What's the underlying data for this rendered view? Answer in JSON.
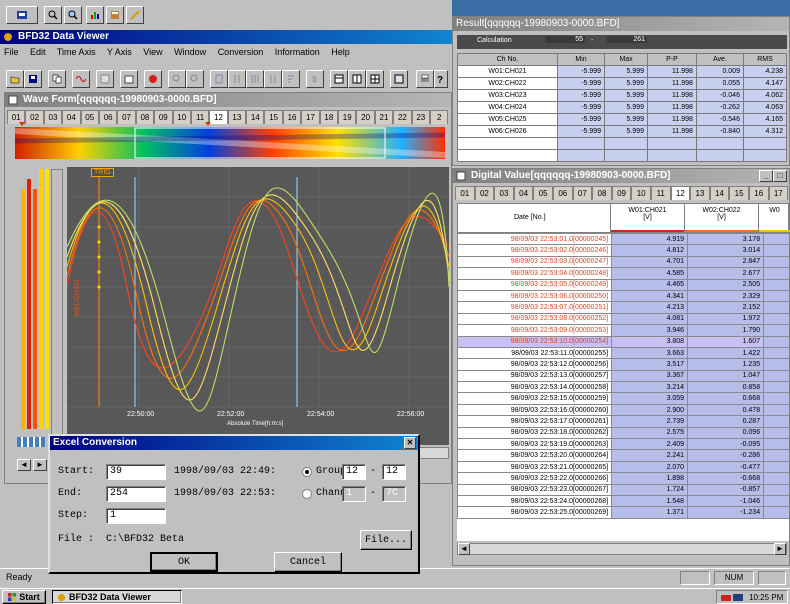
{
  "app": {
    "title": "BFD32 Data Viewer",
    "status_ready": "Ready",
    "status_num": "NUM"
  },
  "menu": [
    "File",
    "Edit",
    "Time Axis",
    "Y Axis",
    "View",
    "Window",
    "Conversion",
    "Information",
    "Help"
  ],
  "waveform": {
    "title": "Wave Form[qqqqqq-19980903-0000.BFD]",
    "tabs": [
      "01",
      "02",
      "03",
      "04",
      "05",
      "06",
      "07",
      "08",
      "09",
      "10",
      "11",
      "12",
      "13",
      "14",
      "15",
      "16",
      "17",
      "18",
      "19",
      "20",
      "21",
      "22",
      "23",
      "2"
    ],
    "trig_label": "TRIG",
    "xlabel": "Absolute Time[h:m:s]",
    "x_ticks": [
      "22:50:00",
      "22:52:00",
      "22:54:00",
      "22:56:00"
    ]
  },
  "result": {
    "title": "Result[qqqqqq-19980903-0000.BFD]",
    "calc_label": "Calculation",
    "calc_from": "55",
    "calc_dash": "-",
    "calc_to": "261",
    "headers": [
      "Ch No.",
      "Min",
      "Max",
      "P-P",
      "Ave.",
      "RMS"
    ],
    "rows": [
      [
        "W01:CH021",
        "-5.999",
        "5.999",
        "11.998",
        "0.009",
        "4.238"
      ],
      [
        "W02:CH022",
        "-5.999",
        "5.999",
        "11.998",
        "0.055",
        "4.147"
      ],
      [
        "W03:CH023",
        "-5.999",
        "5.999",
        "11.998",
        "-0.046",
        "4.062"
      ],
      [
        "W04:CH024",
        "-5.999",
        "5.999",
        "11.998",
        "-0.262",
        "4.063"
      ],
      [
        "W05:CH025",
        "-5.999",
        "5.999",
        "11.998",
        "-0.546",
        "4.165"
      ],
      [
        "W06:CH026",
        "-5.999",
        "5.999",
        "11.998",
        "-0.840",
        "4.312"
      ]
    ]
  },
  "digital": {
    "title": "Digital Value[qqqqqq-19980903-0000.BFD]",
    "tabs": [
      "01",
      "02",
      "03",
      "04",
      "05",
      "06",
      "07",
      "08",
      "09",
      "10",
      "11",
      "12",
      "13",
      "14",
      "15",
      "16",
      "17"
    ],
    "col_date": "Date [No.]",
    "col1": "W01:CH021",
    "col1_unit": "[V]",
    "col2": "W02:CH022",
    "col2_unit": "[V]",
    "col3": "W0",
    "rows": [
      [
        "98/09/03 22:53:01.0[00000245]",
        "4.919",
        "3.178"
      ],
      [
        "98/09/03 22:53:02.0[00000246]",
        "4.812",
        "3.014"
      ],
      [
        "98/09/03 22:53:03.0[00000247]",
        "4.701",
        "2.847"
      ],
      [
        "98/09/03 22:53:04.0[00000248]",
        "4.585",
        "2.677"
      ],
      [
        "98/09/03 22:53:05.0[00000249]",
        "4.465",
        "2.505"
      ],
      [
        "98/09/03 22:53:06.0[00000250]",
        "4.341",
        "2.329"
      ],
      [
        "98/09/03 22:53:07.0[00000251]",
        "4.213",
        "2.152"
      ],
      [
        "98/09/03 22:53:08.0[00000252]",
        "4.081",
        "1.972"
      ],
      [
        "98/09/03 22:53:09.0[00000253]",
        "3.946",
        "1.790"
      ],
      [
        "98/09/03 22:53:10.0[00000254]",
        "3.808",
        "1.607"
      ],
      [
        "98/09/03 22:53:11.0[00000255]",
        "3.663",
        "1.422"
      ],
      [
        "98/09/03 22:53:12.0[00000256]",
        "3.517",
        "1.235"
      ],
      [
        "98/09/03 22:53:13.0[00000257]",
        "3.367",
        "1.047"
      ],
      [
        "98/09/03 22:53:14.0[00000258]",
        "3.214",
        "0.858"
      ],
      [
        "98/09/03 22:53:15.0[00000259]",
        "3.059",
        "0.668"
      ],
      [
        "98/09/03 22:53:16.0[00000260]",
        "2.900",
        "0.478"
      ],
      [
        "98/09/03 22:53:17.0[00000261]",
        "2.739",
        "0.287"
      ],
      [
        "98/09/03 22:53:18.0[00000262]",
        "2.575",
        "0.096"
      ],
      [
        "98/09/03 22:53:19.0[00000263]",
        "2.409",
        "-0.095"
      ],
      [
        "98/09/03 22:53:20.0[00000264]",
        "2.241",
        "-0.286"
      ],
      [
        "98/09/03 22:53:21.0[00000265]",
        "2.070",
        "-0.477"
      ],
      [
        "98/09/03 22:53:22.0[00000266]",
        "1.898",
        "-0.668"
      ],
      [
        "98/09/03 22:53:23.0[00000267]",
        "1.724",
        "-0.857"
      ],
      [
        "98/09/03 22:53:24.0[00000268]",
        "1.548",
        "-1.046"
      ],
      [
        "98/09/03 22:53:25.0[00000269]",
        "1.371",
        "-1.234"
      ]
    ]
  },
  "excel": {
    "title": "Excel Conversion",
    "start_label": "Start:",
    "start_value": "39",
    "start_time": "1998/09/03 22:49:",
    "end_label": "End:",
    "end_value": "254",
    "end_time": "1998/09/03 22:53:",
    "step_label": "Step:",
    "step_value": "1",
    "group_label": "Group",
    "channel_label": "Channel",
    "group_from": "12",
    "group_to": "12",
    "channel_from": "1",
    "channel_to": "7C",
    "dash": "-",
    "file_label": "File :",
    "file_path": "C:\\BFD32 Beta",
    "file_button": "File...",
    "ok_button": "OK",
    "cancel_button": "Cancel"
  },
  "taskbar": {
    "start": "Start",
    "task": "BFD32 Data Viewer",
    "clock": "10:25 PM"
  }
}
